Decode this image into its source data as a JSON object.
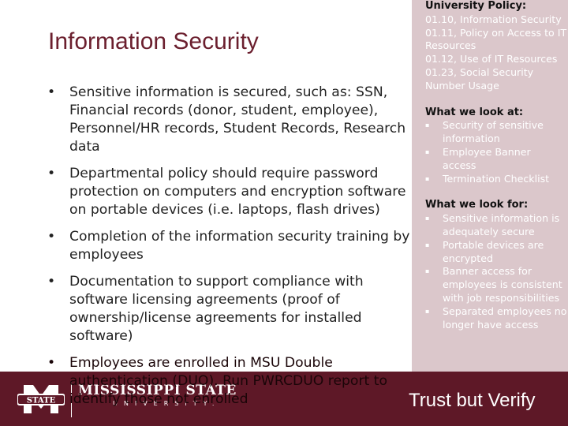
{
  "slide": {
    "title": "Information Security",
    "bullets": [
      "Sensitive information is secured, such as: SSN, Financial records (donor, student, employee), Personnel/HR records, Student Records, Research data",
      "Departmental policy should require password protection on computers and encryption software on portable devices (i.e. laptops, flash drives)",
      "Completion of the information security training by employees",
      "Documentation to support compliance with software licensing agreements (proof of ownership/license agreements for installed software)",
      "Employees are enrolled in MSU Double authentication (DUO). Run PWRCDUO report to identify those not enrolled"
    ]
  },
  "panel": {
    "policy_heading": "University Policy:",
    "policies": [
      "01.10, Information Security",
      "01.11, Policy on Access to IT Resources",
      "01.12, Use of IT Resources",
      "01.23, Social Security Number Usage"
    ],
    "look_at_heading": "What we look at:",
    "look_at": [
      "Security of sensitive information",
      "Employee Banner access",
      "Termination Checklist"
    ],
    "look_for_heading": "What we look for:",
    "look_for": [
      "Sensitive information is adequately secure",
      "Portable devices are encrypted",
      "Banner access for employees is consistent with job responsibilities",
      "Separated employees no longer have access"
    ]
  },
  "footer": {
    "logo_text": "STATE",
    "brand_name": "MISSISSIPPI STATE",
    "brand_sub": "UNIVERSITY.",
    "tagline": "Trust but Verify"
  },
  "colors": {
    "maroon": "#5e1827",
    "title": "#6b1f2e",
    "panel": "#dbc7cb"
  }
}
